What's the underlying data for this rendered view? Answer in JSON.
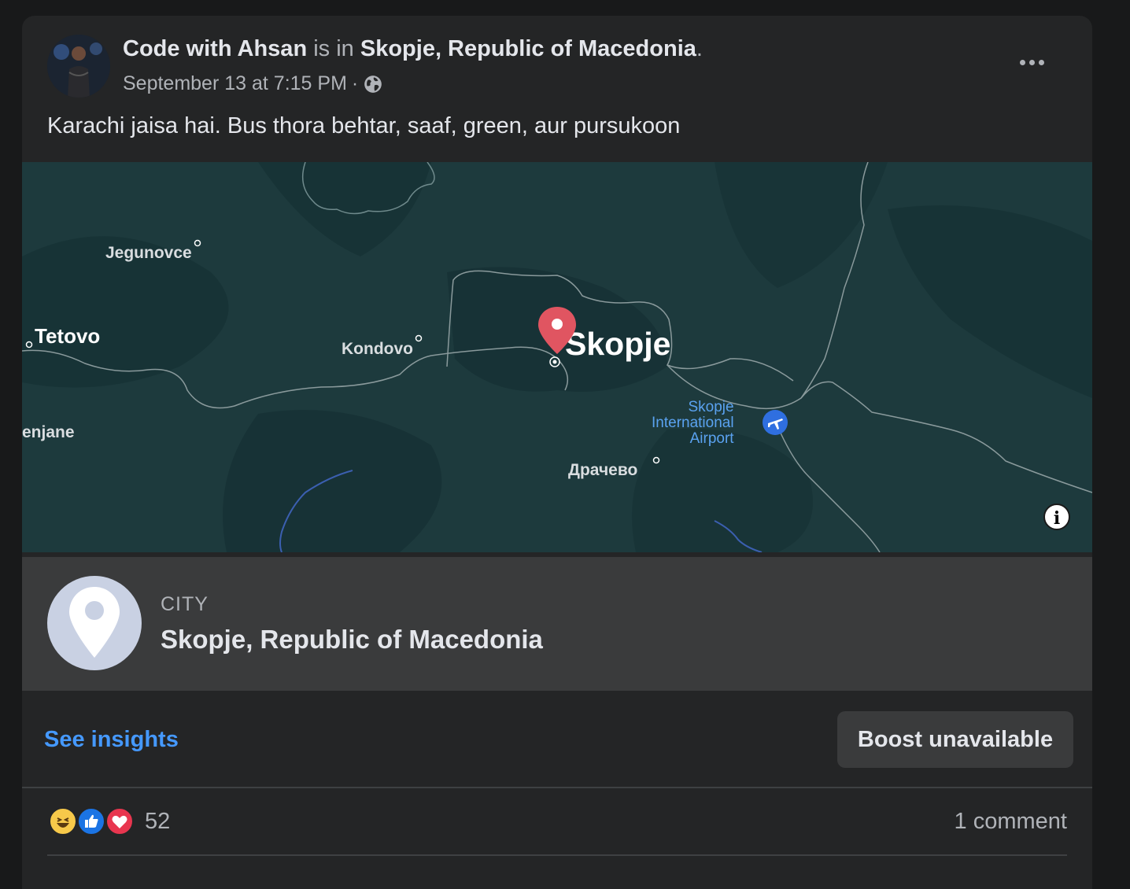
{
  "post": {
    "author": "Code with Ahsan",
    "connector": "is in",
    "location": "Skopje, Republic of Macedonia",
    "period": ".",
    "timestamp": "September 13 at 7:15 PM",
    "separator": "·",
    "privacy_icon": "globe-icon",
    "more_icon": "more-horizontal-icon",
    "text": "Karachi jaisa hai. Bus thora behtar, saaf, green, aur pursukoon"
  },
  "map": {
    "labels": {
      "jegunovce": "Jegunovce",
      "tetovo": "Tetovo",
      "kondovo": "Kondovo",
      "skopje": "Skopje",
      "enjane": "enjane",
      "airport": "Skopje\nInternational\nAirport",
      "dracevo": "Драчево"
    },
    "info_label": "i",
    "colors": {
      "land": "#1d3a3d",
      "pin": "#e05561",
      "airport": "#2f6fe0"
    }
  },
  "place": {
    "type": "CITY",
    "name": "Skopje, Republic of Macedonia",
    "icon": "location-pin-icon"
  },
  "actions": {
    "insights": "See insights",
    "boost": "Boost unavailable"
  },
  "stats": {
    "reaction_icons": [
      "haha-icon",
      "like-icon",
      "love-icon"
    ],
    "reaction_count": "52",
    "comments": "1 comment"
  }
}
